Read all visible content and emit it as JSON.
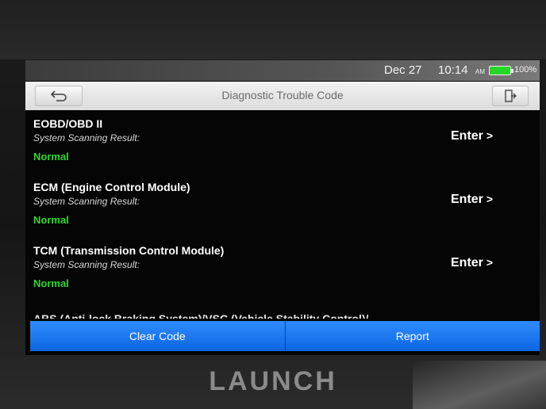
{
  "status_bar": {
    "date": "Dec 27",
    "time": "10:14",
    "ampm": "AM",
    "battery_percent": "100%",
    "battery_level": 1.0,
    "battery_color": "#26d826"
  },
  "title_bar": {
    "title": "Diagnostic Trouble Code",
    "back_icon": "back-arrow-icon",
    "exit_icon": "exit-icon"
  },
  "results": [
    {
      "system": "EOBD/OBD II",
      "scan_label": "System Scanning Result:",
      "scan_value": "Normal",
      "enter_label": "Enter"
    },
    {
      "system": "ECM (Engine Control Module)",
      "scan_label": "System Scanning Result:",
      "scan_value": "Normal",
      "enter_label": "Enter"
    },
    {
      "system": "TCM (Transmission Control Module)",
      "scan_label": "System Scanning Result:",
      "scan_value": "Normal",
      "enter_label": "Enter"
    }
  ],
  "partial_item": "ABS (Anti-lock Braking System)/VSC (Vehicle Stability Control)/",
  "actions": {
    "clear_code": "Clear Code",
    "report": "Report"
  },
  "brand": "LAUNCH",
  "colors": {
    "normal_status": "#2ed82e",
    "button_blue": "#1a74f0"
  }
}
